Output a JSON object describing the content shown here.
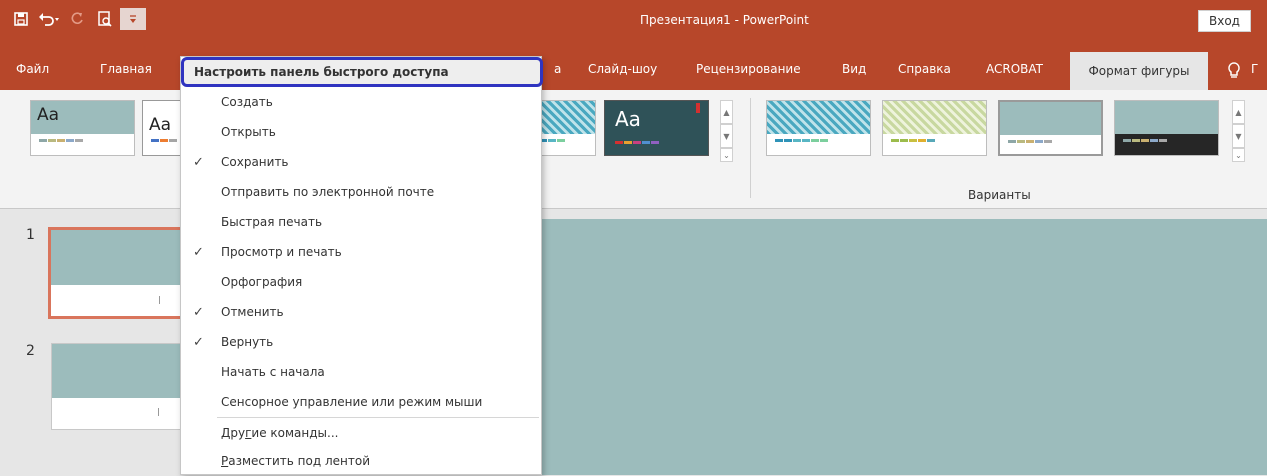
{
  "window": {
    "title": "Презентация1 - PowerPoint",
    "sign_in": "Вход"
  },
  "qat": {
    "icons": [
      "save-icon",
      "undo-icon",
      "redo-icon",
      "print-preview-icon",
      "customize-arrow-icon"
    ]
  },
  "tabs": [
    {
      "label": "Файл"
    },
    {
      "label": "Главная"
    },
    {
      "label": "а"
    },
    {
      "label": "Слайд-шоу"
    },
    {
      "label": "Рецензирование"
    },
    {
      "label": "Вид"
    },
    {
      "label": "Справка"
    },
    {
      "label": "ACROBAT"
    },
    {
      "label": "Формат фигуры"
    }
  ],
  "ribbon": {
    "themes": [
      {
        "label": "Aa"
      },
      {
        "label": "Aa"
      },
      {
        "label": "Aa"
      }
    ],
    "variants_label": "Варианты"
  },
  "slides": [
    {
      "number": "1"
    },
    {
      "number": "2"
    }
  ],
  "menu": {
    "header": "Настроить панель быстрого доступа",
    "items": [
      {
        "label": "Создать",
        "checked": false
      },
      {
        "label": "Открыть",
        "checked": false
      },
      {
        "label": "Сохранить",
        "checked": true
      },
      {
        "label": "Отправить по электронной почте",
        "checked": false
      },
      {
        "label": "Быстрая печать",
        "checked": false
      },
      {
        "label": "Просмотр и печать",
        "checked": true
      },
      {
        "label": "Орфография",
        "checked": false
      },
      {
        "label": "Отменить",
        "checked": true
      },
      {
        "label": "Вернуть",
        "checked": true
      },
      {
        "label": "Начать с начала",
        "checked": false
      },
      {
        "label": "Сенсорное управление или режим мыши",
        "checked": false
      }
    ],
    "more_commands": {
      "accel": "Д",
      "mid": "ру",
      "accel2": "г",
      "rest": "ие команды..."
    },
    "below_ribbon": {
      "accel": "Р",
      "rest": "азместить под лентой"
    },
    "check_glyph": "✓"
  },
  "colors": {
    "accent": "#b7472a",
    "slide_fill": "#9cbcbc",
    "menu_highlight_border": "#2f34c0"
  }
}
